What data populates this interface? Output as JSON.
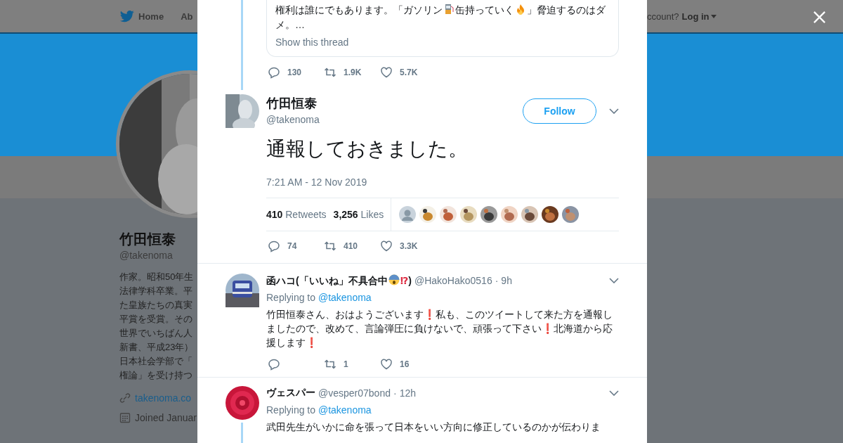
{
  "nav": {
    "items": [
      {
        "label": "Home",
        "kind": "home"
      },
      {
        "label": "Ab",
        "kind": "plain"
      }
    ],
    "account_prompt": "ccount?",
    "login": "Log in"
  },
  "profile": {
    "name": "竹田恒泰",
    "handle": "@takenoma",
    "bio_lines": [
      "作家。昭和50年生",
      "法律学科卒業。平",
      "た皇族たちの真実",
      "平賞を受賞。その",
      "世界でいちばん人",
      "新書、平成23年）",
      "日本社会学部で「",
      "権論」を受け持つ"
    ],
    "link": "takenoma.co",
    "joined": "Joined Januar"
  },
  "quoted": {
    "text_parts": [
      {
        "kind": "text",
        "text": "権利は誰にでもあります。「ガソリン"
      },
      {
        "kind": "pump"
      },
      {
        "kind": "text",
        "text": "缶持っていく"
      },
      {
        "kind": "fire"
      },
      {
        "kind": "text",
        "text": "」脅迫するのはダメ。…"
      }
    ],
    "show_thread": "Show this thread",
    "actions": {
      "replies": "130",
      "retweets": "1.9K",
      "likes": "5.7K"
    }
  },
  "tweet": {
    "name": "竹田恒泰",
    "handle": "@takenoma",
    "follow": "Follow",
    "text": "通報しておきました。",
    "timestamp": "7:21 AM - 12 Nov 2019",
    "retweets": "410",
    "retweets_label": "Retweets",
    "likes": "3,256",
    "likes_label": "Likes",
    "likers": [
      {
        "kind": "default"
      },
      {
        "kind": "picture"
      },
      {
        "kind": "picture"
      },
      {
        "kind": "picture"
      },
      {
        "kind": "picture"
      },
      {
        "kind": "picture"
      },
      {
        "kind": "picture"
      },
      {
        "kind": "picture"
      },
      {
        "kind": "picture"
      }
    ],
    "actions": {
      "replies": "74",
      "retweets": "410",
      "likes": "3.3K"
    }
  },
  "replies": [
    {
      "name_parts": [
        {
          "kind": "text",
          "text": "函ハコ(「いいね」不具合中"
        },
        {
          "kind": "shock"
        },
        {
          "kind": "mark",
          "text": "⁉"
        },
        {
          "kind": "text",
          "text": ")"
        }
      ],
      "handle": "@HakoHako0516",
      "separator": "·",
      "time": "9h",
      "replying_label": "Replying to",
      "replying_to": "@takenoma",
      "thread_line": false,
      "text_parts": [
        {
          "kind": "text",
          "text": "竹田恒泰さん、おはようございます"
        },
        {
          "kind": "mark",
          "text": "❗"
        },
        {
          "kind": "text",
          "text": "私も、このツイートして来た方を通報しましたので、改めて、言論弾圧に負けないで、頑張って下さい"
        },
        {
          "kind": "mark",
          "text": "❗"
        },
        {
          "kind": "text",
          "text": "北海道から応援します"
        },
        {
          "kind": "mark",
          "text": "❗"
        }
      ],
      "actions": {
        "retweets": "1",
        "likes": "16"
      }
    },
    {
      "name_parts": [
        {
          "kind": "text",
          "text": "ヴェスパー"
        }
      ],
      "handle": "@vesper07bond",
      "separator": "·",
      "time": "12h",
      "replying_label": "Replying to",
      "replying_to": "@takenoma",
      "thread_line": true,
      "text_parts": [
        {
          "kind": "text",
          "text": "武田先生がいかに命を張って日本をいい方向に修正しているのかが伝わりま"
        }
      ]
    }
  ]
}
